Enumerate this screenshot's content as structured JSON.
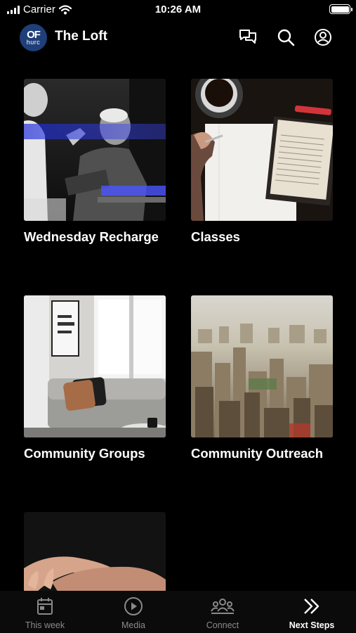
{
  "status_bar": {
    "carrier": "Carrier",
    "time": "10:26 AM"
  },
  "header": {
    "logo_top": "OF",
    "logo_bottom": "hurc",
    "title": "The Loft"
  },
  "header_icons": [
    "chat-icon",
    "search-icon",
    "profile-icon"
  ],
  "cards": [
    {
      "title": "Wednesday Recharge",
      "image": "speaker-with-bible"
    },
    {
      "title": "Classes",
      "image": "open-bible-and-notebook"
    },
    {
      "title": "Community Groups",
      "image": "living-room-couch"
    },
    {
      "title": "Community Outreach",
      "image": "city-skyline"
    },
    {
      "title": "",
      "image": "open-hands"
    }
  ],
  "tabs": [
    {
      "label": "This week",
      "icon": "calendar-icon",
      "active": false
    },
    {
      "label": "Media",
      "icon": "play-icon",
      "active": false
    },
    {
      "label": "Connect",
      "icon": "group-icon",
      "active": false
    },
    {
      "label": "Next Steps",
      "icon": "double-chevron-right-icon",
      "active": true
    }
  ],
  "colors": {
    "background": "#000000",
    "tab_inactive": "#8a8a8a",
    "tab_active": "#ffffff",
    "logo_bg": "#1f3f7a"
  }
}
